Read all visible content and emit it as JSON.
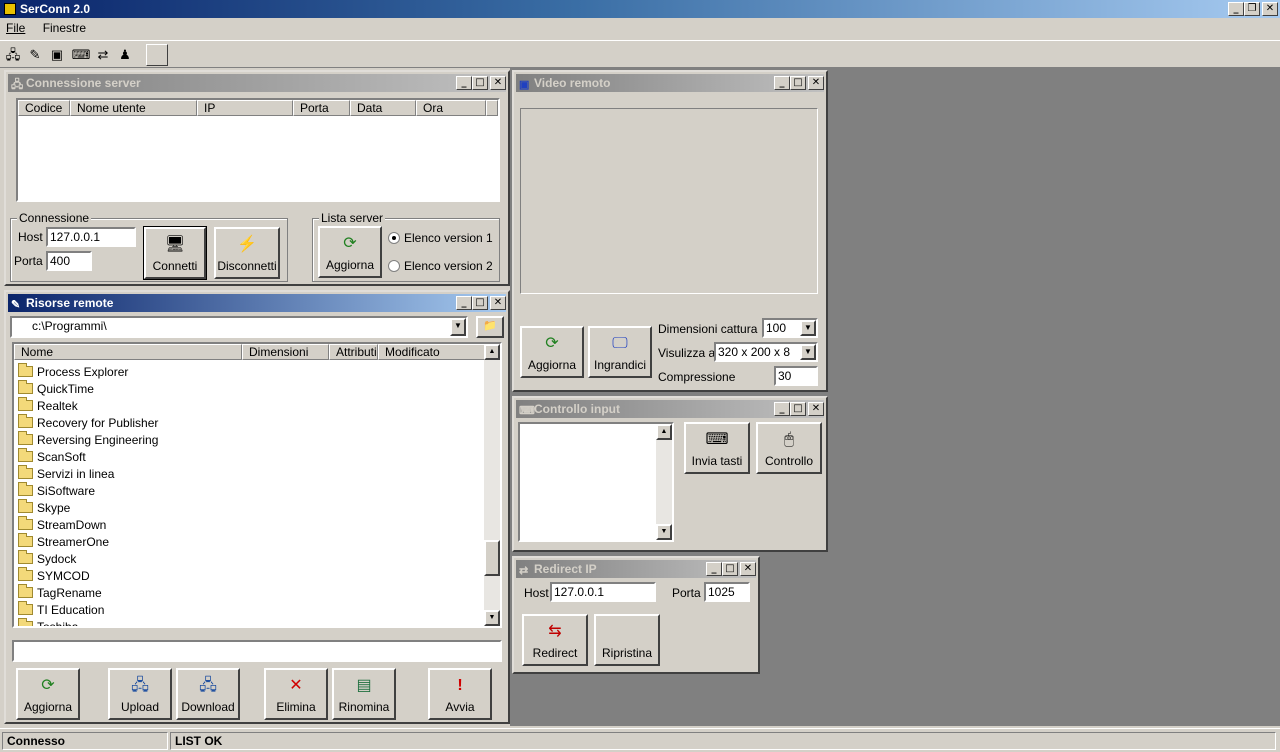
{
  "app": {
    "title": "SerConn 2.0"
  },
  "menu": [
    "File",
    "Finestre"
  ],
  "win_server": {
    "title": "Connessione server",
    "columns": [
      "Codice",
      "Nome utente",
      "IP",
      "Porta",
      "Data",
      "Ora"
    ],
    "connection_group": "Connessione",
    "host_label": "Host",
    "host_value": "127.0.0.1",
    "port_label": "Porta",
    "port_value": "400",
    "connect": "Connetti",
    "disconnect": "Disconnetti",
    "list_group": "Lista server",
    "refresh": "Aggiorna",
    "radio1": "Elenco version 1",
    "radio2": "Elenco version 2"
  },
  "win_resources": {
    "title": "Risorse remote",
    "path": "c:\\Programmi\\",
    "columns": [
      "Nome",
      "Dimensioni",
      "Attributi",
      "Modificato"
    ],
    "files": [
      "Process Explorer",
      "QuickTime",
      "Realtek",
      "Recovery for Publisher",
      "Reversing Engineering",
      "ScanSoft",
      "Servizi in linea",
      "SiSoftware",
      "Skype",
      "StreamDown",
      "StreamerOne",
      "Sydock",
      "SYMCOD",
      "TagRename",
      "TI Education",
      "Toshiba"
    ],
    "buttons": {
      "refresh": "Aggiorna",
      "upload": "Upload",
      "download": "Download",
      "delete": "Elimina",
      "rename": "Rinomina",
      "start": "Avvia"
    }
  },
  "win_video": {
    "title": "Video remoto",
    "refresh": "Aggiorna",
    "enlarge": "Ingrandici",
    "capture_label": "Dimensioni cattura",
    "capture_value": "100",
    "view_label": "Visulizza a",
    "view_value": "320 x 200 x 8",
    "compress_label": "Compressione",
    "compress_value": "30"
  },
  "win_input": {
    "title": "Controllo input",
    "send_keys": "Invia tasti",
    "control": "Controllo"
  },
  "win_redirect": {
    "title": "Redirect IP",
    "host_label": "Host",
    "host_value": "127.0.0.1",
    "port_label": "Porta",
    "port_value": "1025",
    "redirect": "Redirect",
    "restore": "Ripristina"
  },
  "status": {
    "left": "Connesso",
    "right": "LIST OK"
  },
  "colors": {
    "face": "#d4d0c8",
    "title_active": "#0a246a",
    "mdi_bg": "#808080"
  }
}
